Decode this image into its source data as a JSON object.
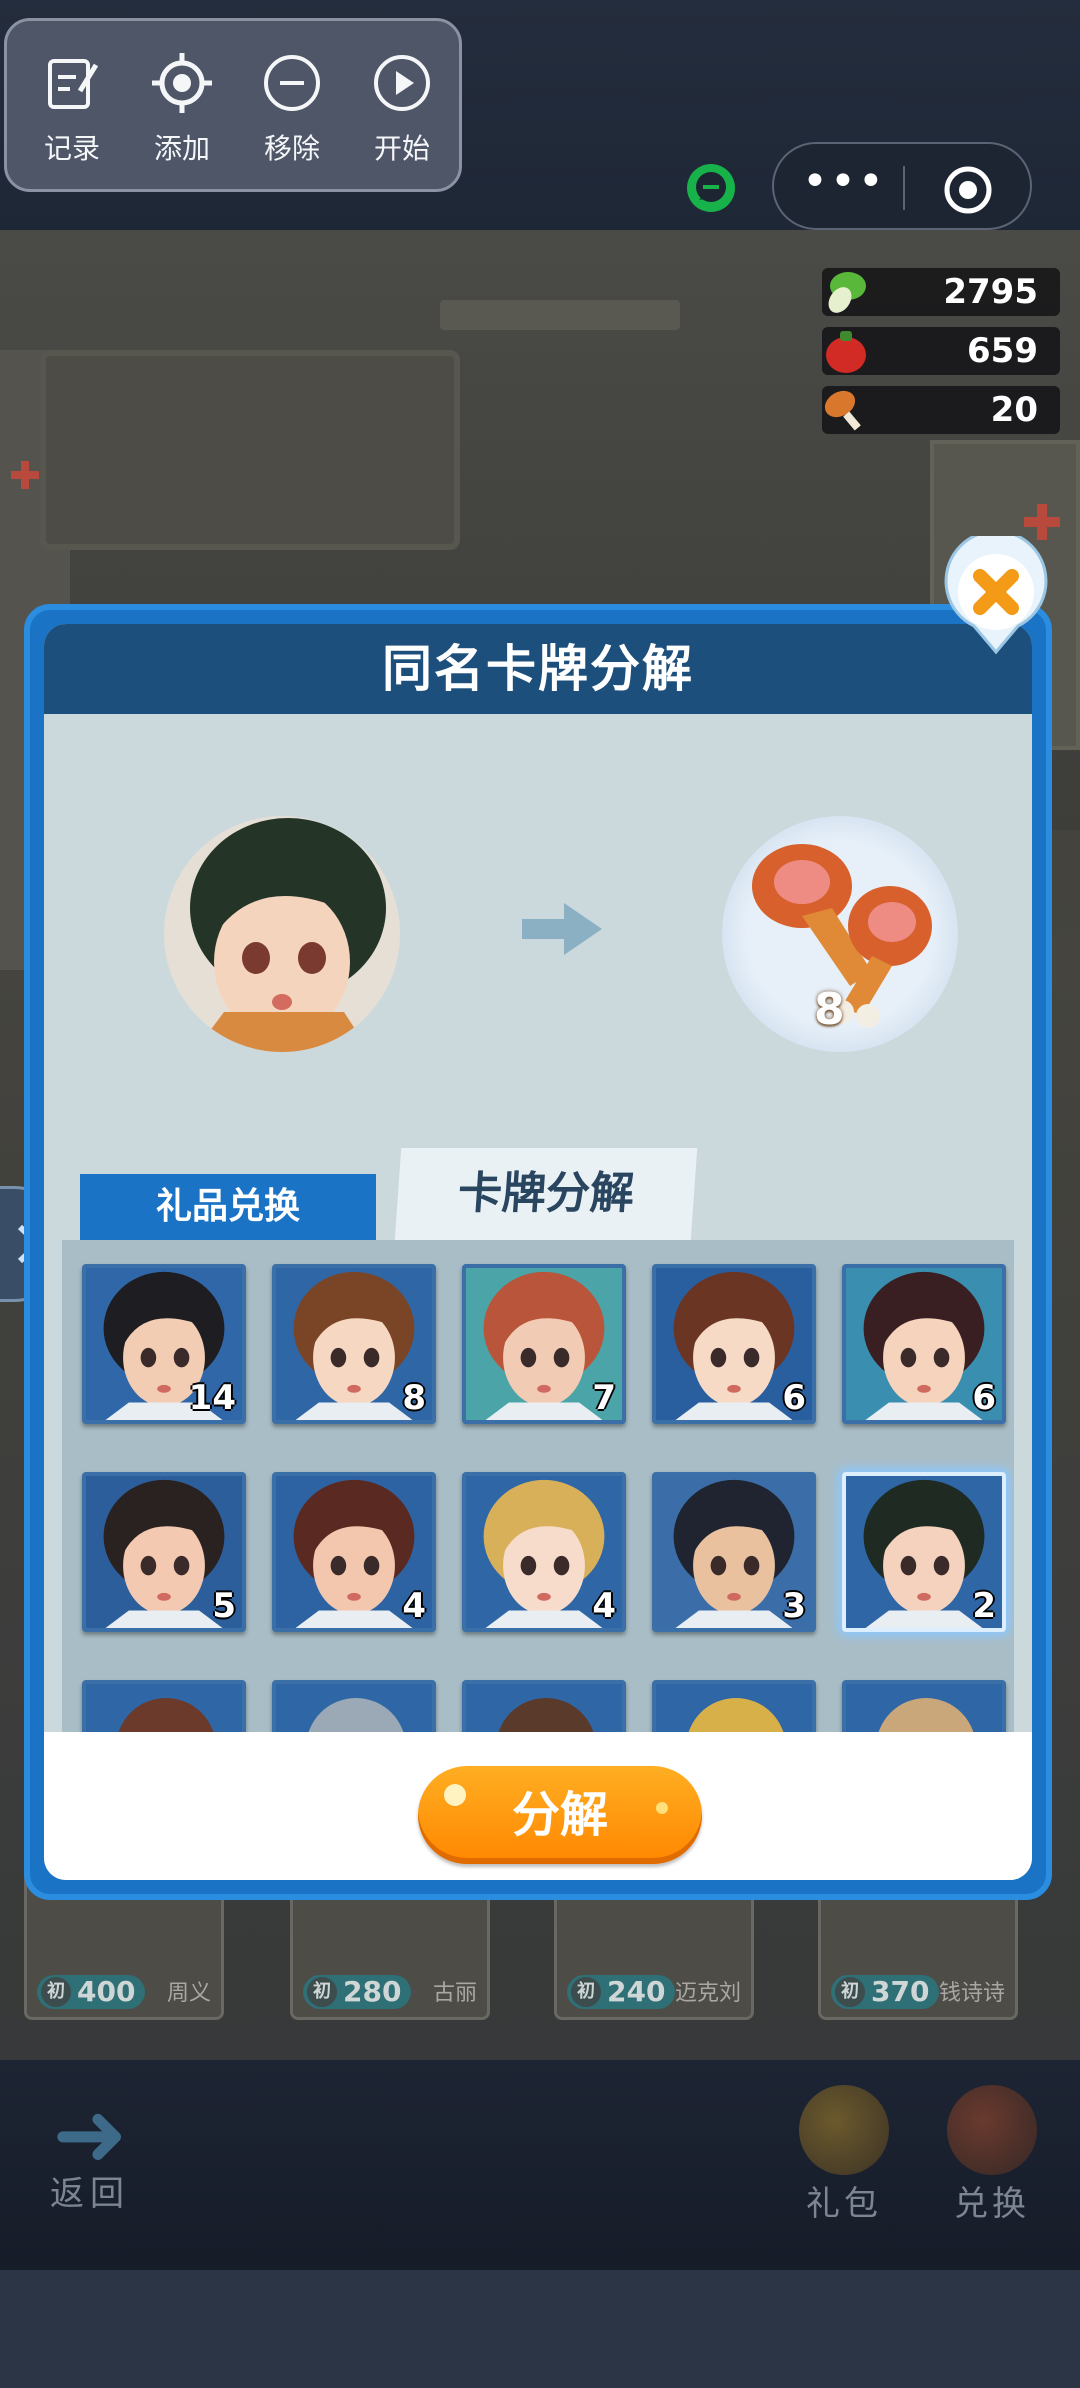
{
  "toolbar": {
    "tools": [
      {
        "label": "记录",
        "icon": "edit-note-icon"
      },
      {
        "label": "添加",
        "icon": "crosshair-icon"
      },
      {
        "label": "移除",
        "icon": "minus-circle-icon"
      },
      {
        "label": "开始",
        "icon": "play-circle-icon"
      }
    ]
  },
  "capsule": {
    "more_icon": "more-dots-icon",
    "close_icon": "target-close-icon"
  },
  "resources": [
    {
      "icon": "vegetable-icon",
      "value": "2795"
    },
    {
      "icon": "pepper-icon",
      "value": "659"
    },
    {
      "icon": "drumstick-icon",
      "value": "20"
    }
  ],
  "background_cards": [
    {
      "cost": "400",
      "name": "周义"
    },
    {
      "cost": "280",
      "name": "古丽"
    },
    {
      "cost": "240",
      "name": "迈克刘"
    },
    {
      "cost": "370",
      "name": "钱诗诗"
    }
  ],
  "bottom_nav": {
    "back": "返回",
    "gift_pack": "礼包",
    "exchange": "兑换"
  },
  "dialog": {
    "title": "同名卡牌分解",
    "reward_count": "8",
    "tabs": {
      "gift_exchange": "礼品兑换",
      "card_decompose": "卡牌分解"
    },
    "cards": [
      {
        "count": "14",
        "hair": "#1e1e22",
        "bg": "#3067a8",
        "skin": "#f2cdb4"
      },
      {
        "count": "8",
        "hair": "#7a4527",
        "bg": "#2f66a6",
        "skin": "#f6d7c1"
      },
      {
        "count": "7",
        "hair": "#b8553a",
        "bg": "#4aa4a8",
        "skin": "#f2cbb4"
      },
      {
        "count": "6",
        "hair": "#6b3524",
        "bg": "#2a5f9f",
        "skin": "#f7dac6"
      },
      {
        "count": "6",
        "hair": "#3a1f22",
        "bg": "#3a8fb0",
        "skin": "#f5d3bd"
      },
      {
        "count": "5",
        "hair": "#2a2221",
        "bg": "#2c5e9b",
        "skin": "#f3c9b1"
      },
      {
        "count": "4",
        "hair": "#5a2a22",
        "bg": "#2d63a3",
        "skin": "#f2c7ad"
      },
      {
        "count": "4",
        "hair": "#d8b05a",
        "bg": "#2f66a6",
        "skin": "#f7dccb"
      },
      {
        "count": "3",
        "hair": "#1f2430",
        "bg": "#3b6ea8",
        "skin": "#e9c19f"
      },
      {
        "count": "2",
        "hair": "#1e2a22",
        "bg": "#2f66a6",
        "skin": "#f5d2bd"
      }
    ],
    "selected_index": 9,
    "decompose_button": "分解"
  },
  "colors": {
    "dialog_frame": "#1a73c4",
    "title_bar": "#1d4f7c",
    "button_orange": "#ff8700",
    "resource_bg": "#141416"
  }
}
